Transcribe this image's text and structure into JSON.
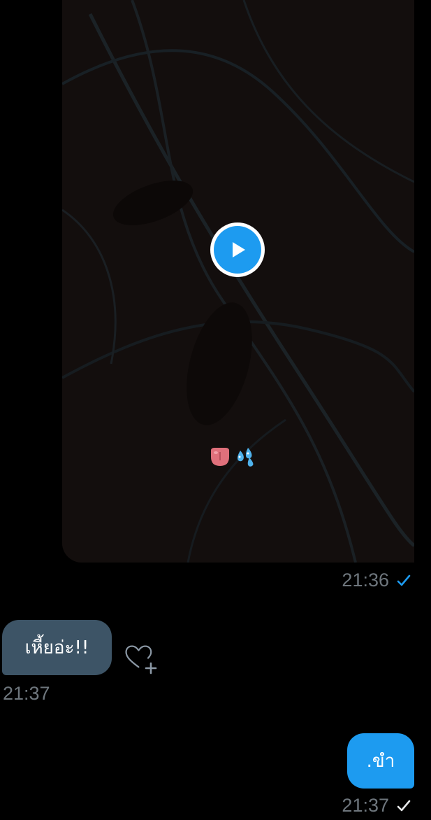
{
  "conversation": {
    "messages": [
      {
        "type": "video",
        "direction": "sent",
        "overlay_emoji": [
          "👅",
          "💦"
        ],
        "timestamp": "21:36",
        "status_icon": "check-icon",
        "status_color": "#1d9bf0"
      },
      {
        "type": "text",
        "direction": "received",
        "text": "เหี้ยอ่ะ!!",
        "timestamp": "21:37",
        "action_icon": "add-reaction-heart-icon"
      },
      {
        "type": "text",
        "direction": "sent",
        "text": ".ขำ",
        "timestamp": "21:37",
        "status_icon": "check-icon",
        "status_color": "#e7e9ea"
      }
    ]
  },
  "colors": {
    "background": "#000000",
    "accent": "#1d9bf0",
    "received_bubble": "#3d5466",
    "timestamp": "#6e767d"
  }
}
